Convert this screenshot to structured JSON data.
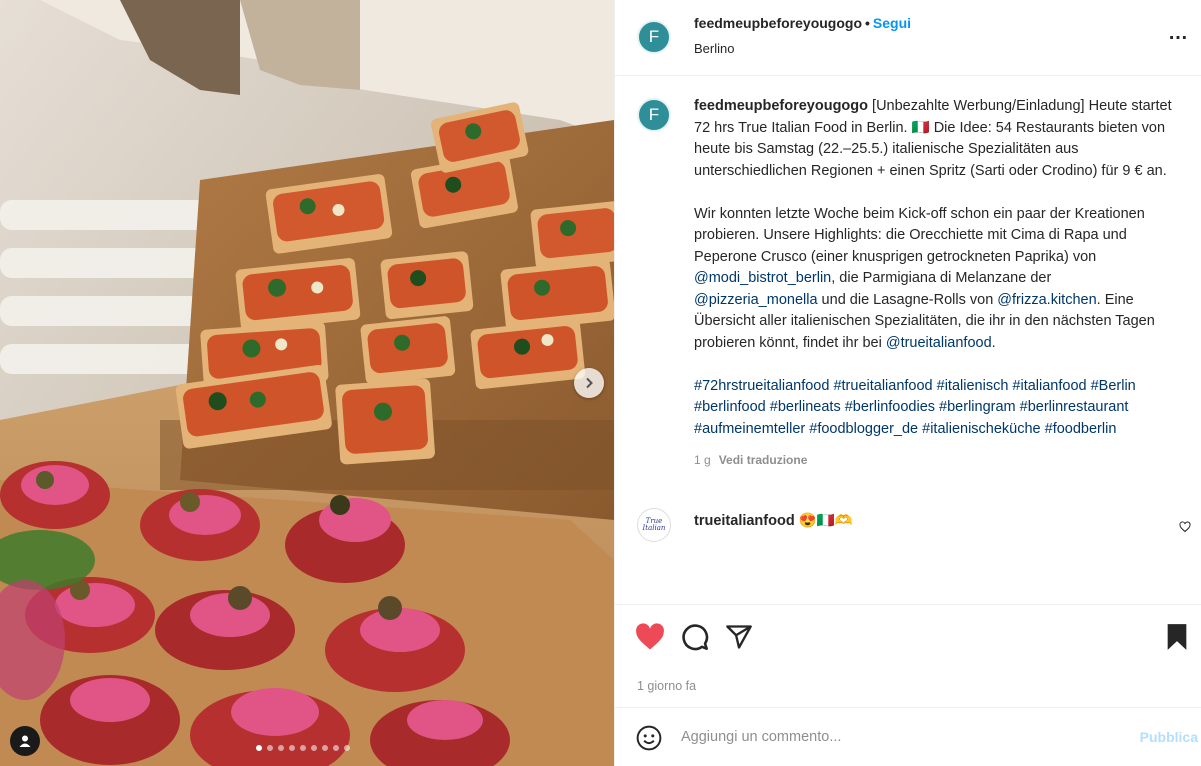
{
  "post": {
    "username": "feedmeupbeforeyougogo",
    "separator": "•",
    "follow_label": "Segui",
    "location": "Berlino",
    "more_label": "…",
    "avatar_letter": "F",
    "accent_color": "#0095f6",
    "liked_color": "#ed4956"
  },
  "caption": {
    "username": "feedmeupbeforeyougogo",
    "line1": "[Unbezahlte Werbung/Einladung] Heute startet 72 hrs True Italian Food in Berlin. 🇮🇹 Die Idee: 54 Restaurants bieten von heute bis Samstag (22.–25.5.) italienische Spezialitäten aus unterschiedlichen Regionen + einen Spritz (Sarti oder Crodino) für 9 € an.",
    "p2_a": "Wir konnten letzte Woche beim Kick-off schon ein paar der Kreationen probieren. Unsere Highlights: die Orecchiette mit Cima di Rapa und Peperone Crusco (einer knusprigen getrockneten Paprika) von ",
    "mention1": "@modi_bistrot_berlin",
    "p2_b": ", die Parmigiana di Melanzane der ",
    "mention2": "@pizzeria_monella",
    "p2_c": " und die Lasagne-Rolls von ",
    "mention3": "@frizza.kitchen",
    "p2_d": ". Eine Übersicht aller italienischen Spezialitäten, die ihr in den nächsten Tagen probieren könnt, findet ihr bei ",
    "mention4": "@trueitalianfood",
    "p2_e": ".",
    "hashtags": "#72hrstrueitalianfood #trueitalianfood #italienisch #italianfood #Berlin #berlinfood #berlineats #berlinfoodies #berlingram #berlinrestaurant #aufmeinemteller #foodblogger_de #italienischeküche #foodberlin",
    "age": "1 g",
    "translate_label": "Vedi traduzione"
  },
  "reply": {
    "avatar_text": "True Italian",
    "username": "trueitalianfood",
    "text": "😍🇮🇹🫶"
  },
  "actions": {
    "like_icon": "heart-filled-icon",
    "comment_icon": "comment-icon",
    "share_icon": "share-icon",
    "save_icon": "bookmark-filled-icon",
    "time": "1 giorno fa"
  },
  "composer": {
    "emoji_icon": "emoji-icon",
    "placeholder": "Aggiungi un commento...",
    "publish_label": "Pubblica"
  },
  "carousel": {
    "slide_count": 9,
    "active_index": 0
  }
}
